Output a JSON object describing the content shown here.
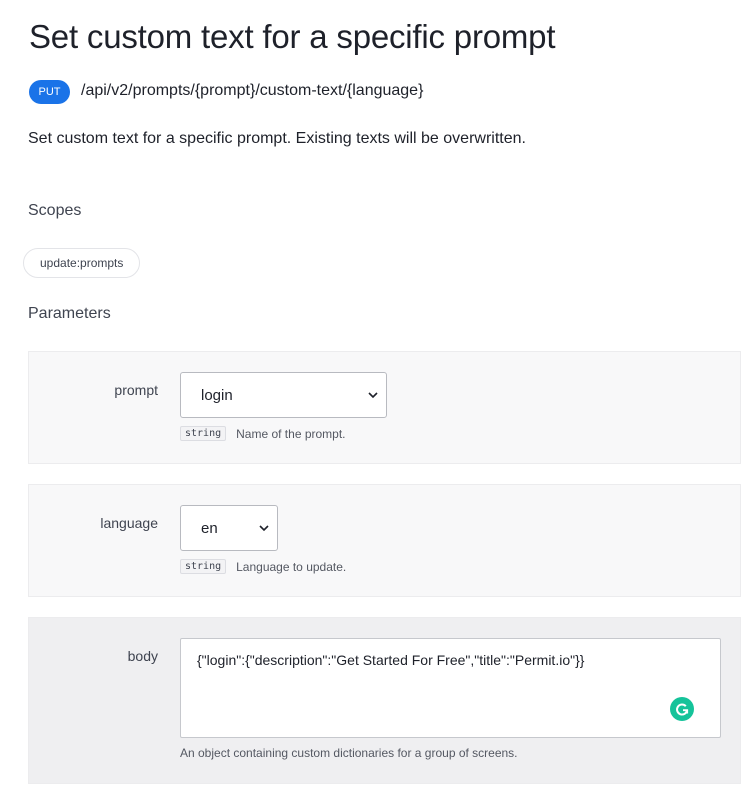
{
  "page": {
    "title": "Set custom text for a specific prompt",
    "method": "PUT",
    "path": "/api/v2/prompts/{prompt}/custom-text/{language}",
    "description": "Set custom text for a specific prompt. Existing texts will be overwritten."
  },
  "scopes": {
    "heading": "Scopes",
    "items": [
      "update:prompts"
    ]
  },
  "parameters": {
    "heading": "Parameters",
    "items": [
      {
        "name": "prompt",
        "type": "string",
        "value": "login",
        "description": "Name of the prompt."
      },
      {
        "name": "language",
        "type": "string",
        "value": "en",
        "description": "Language to update."
      },
      {
        "name": "body",
        "value": "{\"login\":{\"description\":\"Get Started For Free\",\"title\":\"Permit.io\"}}",
        "description": "An object containing custom dictionaries for a group of screens."
      }
    ]
  },
  "icons": {
    "select_chevron": "chevron-down-icon",
    "grammarly": "grammarly-icon"
  },
  "colors": {
    "method_badge": "#1a73e8",
    "grammarly": "#15c39a",
    "panel_bg": "#f8f8f9",
    "panel_active_bg": "#efeff1"
  }
}
